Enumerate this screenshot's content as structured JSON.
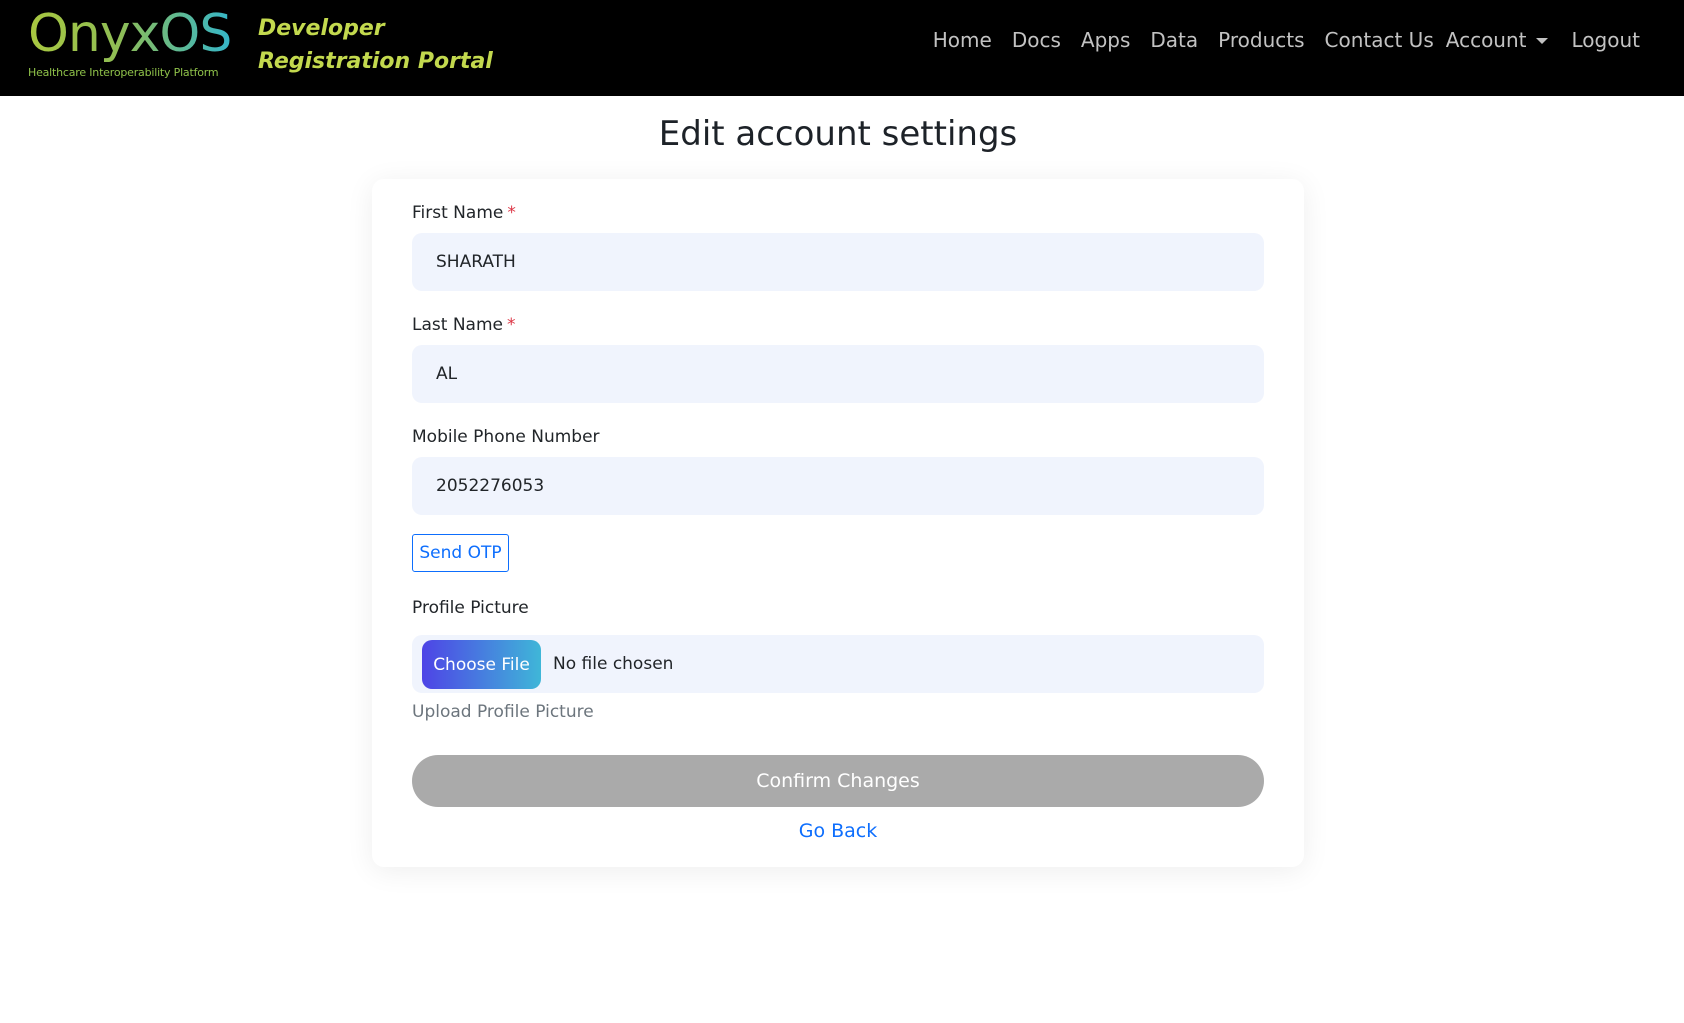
{
  "header": {
    "logo_text": "OnyxOS",
    "logo_tagline": "Healthcare Interoperability Platform",
    "portal_title": "Developer Registration Portal",
    "nav": {
      "home": "Home",
      "docs": "Docs",
      "apps": "Apps",
      "data": "Data",
      "products": "Products",
      "contact": "Contact Us",
      "account": "Account",
      "logout": "Logout"
    }
  },
  "page": {
    "title": "Edit account settings"
  },
  "form": {
    "first_name": {
      "label": "First Name",
      "required_mark": "*",
      "value": "SHARATH"
    },
    "last_name": {
      "label": "Last Name",
      "required_mark": "*",
      "value": "AL"
    },
    "phone": {
      "label": "Mobile Phone Number",
      "value": "2052276053"
    },
    "send_otp_label": "Send OTP",
    "profile_picture": {
      "label": "Profile Picture",
      "choose_label": "Choose File",
      "status": "No file chosen",
      "hint": "Upload Profile Picture"
    },
    "confirm_label": "Confirm Changes",
    "go_back_label": "Go Back"
  },
  "colors": {
    "navbar_bg": "#000000",
    "accent_blue": "#0d6efd",
    "required_red": "#dc3545",
    "input_bg": "#f0f4fd",
    "confirm_disabled": "#aaaaaa",
    "portal_title": "#c3d94e"
  }
}
